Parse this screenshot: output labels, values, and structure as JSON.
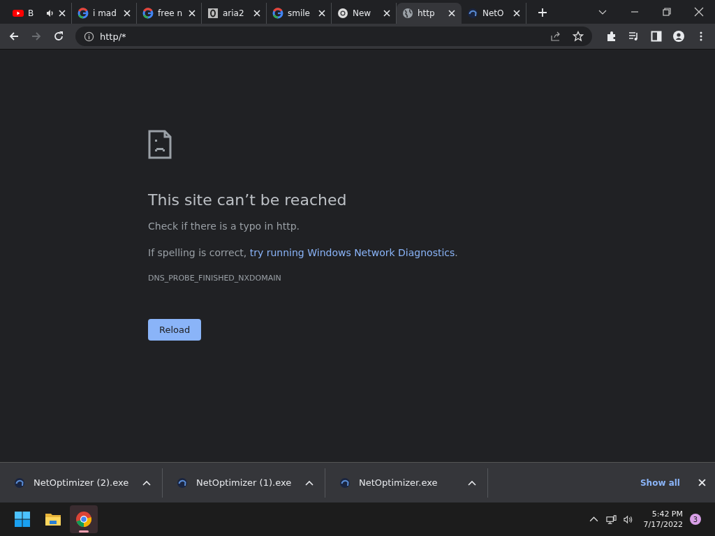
{
  "tabs": [
    {
      "kind": "youtube",
      "title": "B",
      "audio": true,
      "selected": false
    },
    {
      "kind": "google",
      "title": "i mad",
      "audio": false,
      "selected": false
    },
    {
      "kind": "google",
      "title": "free n",
      "audio": false,
      "selected": false
    },
    {
      "kind": "boxed",
      "title": "aria2",
      "audio": false,
      "selected": false
    },
    {
      "kind": "google",
      "title": "smile",
      "audio": false,
      "selected": false
    },
    {
      "kind": "chrome",
      "title": "New",
      "audio": false,
      "selected": false
    },
    {
      "kind": "globe",
      "title": "http",
      "audio": false,
      "selected": true
    },
    {
      "kind": "swirl",
      "title": "NetO",
      "audio": false,
      "selected": false
    }
  ],
  "toolbar": {
    "address": "http/*"
  },
  "error": {
    "heading": "This site can’t be reached",
    "hint": "Check if there is a typo in http.",
    "advice": "If spelling is correct, ",
    "advice_link": "try running Windows Network Diagnostics",
    "advice_end": ".",
    "code": "DNS_PROBE_FINISHED_NXDOMAIN",
    "button": "Reload"
  },
  "downloads": {
    "items": [
      {
        "name": "NetOptimizer (2).exe"
      },
      {
        "name": "NetOptimizer (1).exe"
      },
      {
        "name": "NetOptimizer.exe"
      }
    ],
    "show_all": "Show all"
  },
  "taskbar": {
    "apps": [
      {
        "kind": "start",
        "active": false
      },
      {
        "kind": "explorer",
        "active": false
      },
      {
        "kind": "chrome",
        "active": true
      }
    ],
    "time": "5:42 PM",
    "date": "7/17/2022",
    "badge": "3"
  }
}
